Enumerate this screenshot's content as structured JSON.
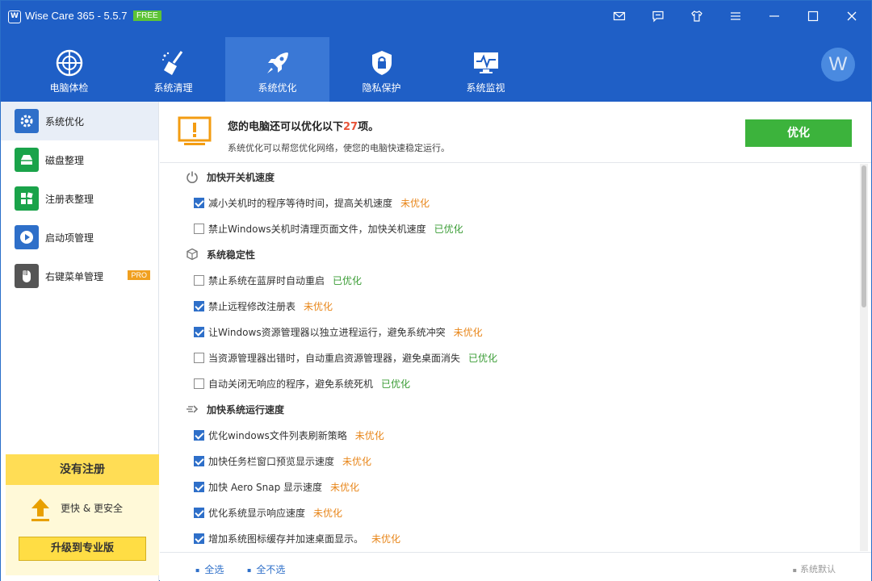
{
  "app": {
    "title": "Wise Care 365 - 5.5.7",
    "free_badge": "FREE"
  },
  "nav": [
    {
      "label": "电脑体检",
      "icon": "radar-icon"
    },
    {
      "label": "系统清理",
      "icon": "broom-icon"
    },
    {
      "label": "系统优化",
      "icon": "rocket-icon"
    },
    {
      "label": "隐私保护",
      "icon": "lock-shield-icon"
    },
    {
      "label": "系统监视",
      "icon": "monitor-pulse-icon"
    }
  ],
  "avatar_letter": "W",
  "sidebar": {
    "items": [
      {
        "label": "系统优化",
        "icon": "gear-icon",
        "color": "#2e6fc9"
      },
      {
        "label": "磁盘整理",
        "icon": "disk-icon",
        "color": "#1aa34a"
      },
      {
        "label": "注册表整理",
        "icon": "registry-icon",
        "color": "#1aa34a"
      },
      {
        "label": "启动项管理",
        "icon": "play-icon",
        "color": "#2e6fc9"
      },
      {
        "label": "右键菜单管理",
        "icon": "mouse-icon",
        "color": "#555555"
      }
    ],
    "pro_badge": "PRO",
    "register": {
      "title": "没有注册",
      "tagline": "更快 & 更安全",
      "upgrade_label": "升级到专业版"
    }
  },
  "header": {
    "title_prefix": "您的电脑还可以优化以下",
    "count": "27",
    "title_suffix": "项。",
    "subtitle": "系统优化可以帮您优化网络，使您的电脑快速稳定运行。",
    "optimize_label": "优化"
  },
  "sections": [
    {
      "title": "加快开关机速度",
      "icon": "power-icon",
      "items": [
        {
          "text": "减小关机时的程序等待时间，提高关机速度",
          "checked": true,
          "status": "未优化",
          "state": "pending"
        },
        {
          "text": "禁止Windows关机时清理页面文件，加快关机速度",
          "checked": false,
          "status": "已优化",
          "state": "done"
        }
      ]
    },
    {
      "title": "系统稳定性",
      "icon": "cube-icon",
      "items": [
        {
          "text": "禁止系统在蓝屏时自动重启",
          "checked": false,
          "status": "已优化",
          "state": "done"
        },
        {
          "text": "禁止远程修改注册表",
          "checked": true,
          "status": "未优化",
          "state": "pending"
        },
        {
          "text": "让Windows资源管理器以独立进程运行，避免系统冲突",
          "checked": true,
          "status": "未优化",
          "state": "pending"
        },
        {
          "text": "当资源管理器出错时，自动重启资源管理器，避免桌面消失",
          "checked": false,
          "status": "已优化",
          "state": "done"
        },
        {
          "text": "自动关闭无响应的程序，避免系统死机",
          "checked": false,
          "status": "已优化",
          "state": "done"
        }
      ]
    },
    {
      "title": "加快系统运行速度",
      "icon": "speed-icon",
      "items": [
        {
          "text": "优化windows文件列表刷新策略",
          "checked": true,
          "status": "未优化",
          "state": "pending"
        },
        {
          "text": "加快任务栏窗口预览显示速度",
          "checked": true,
          "status": "未优化",
          "state": "pending"
        },
        {
          "text": "加快 Aero Snap 显示速度",
          "checked": true,
          "status": "未优化",
          "state": "pending"
        },
        {
          "text": "优化系统显示响应速度",
          "checked": true,
          "status": "未优化",
          "state": "pending"
        },
        {
          "text": "增加系统图标缓存并加速桌面显示。",
          "checked": true,
          "status": "未优化",
          "state": "pending"
        }
      ]
    }
  ],
  "footer": {
    "select_all": "全选",
    "select_none": "全不选",
    "default": "系统默认"
  }
}
